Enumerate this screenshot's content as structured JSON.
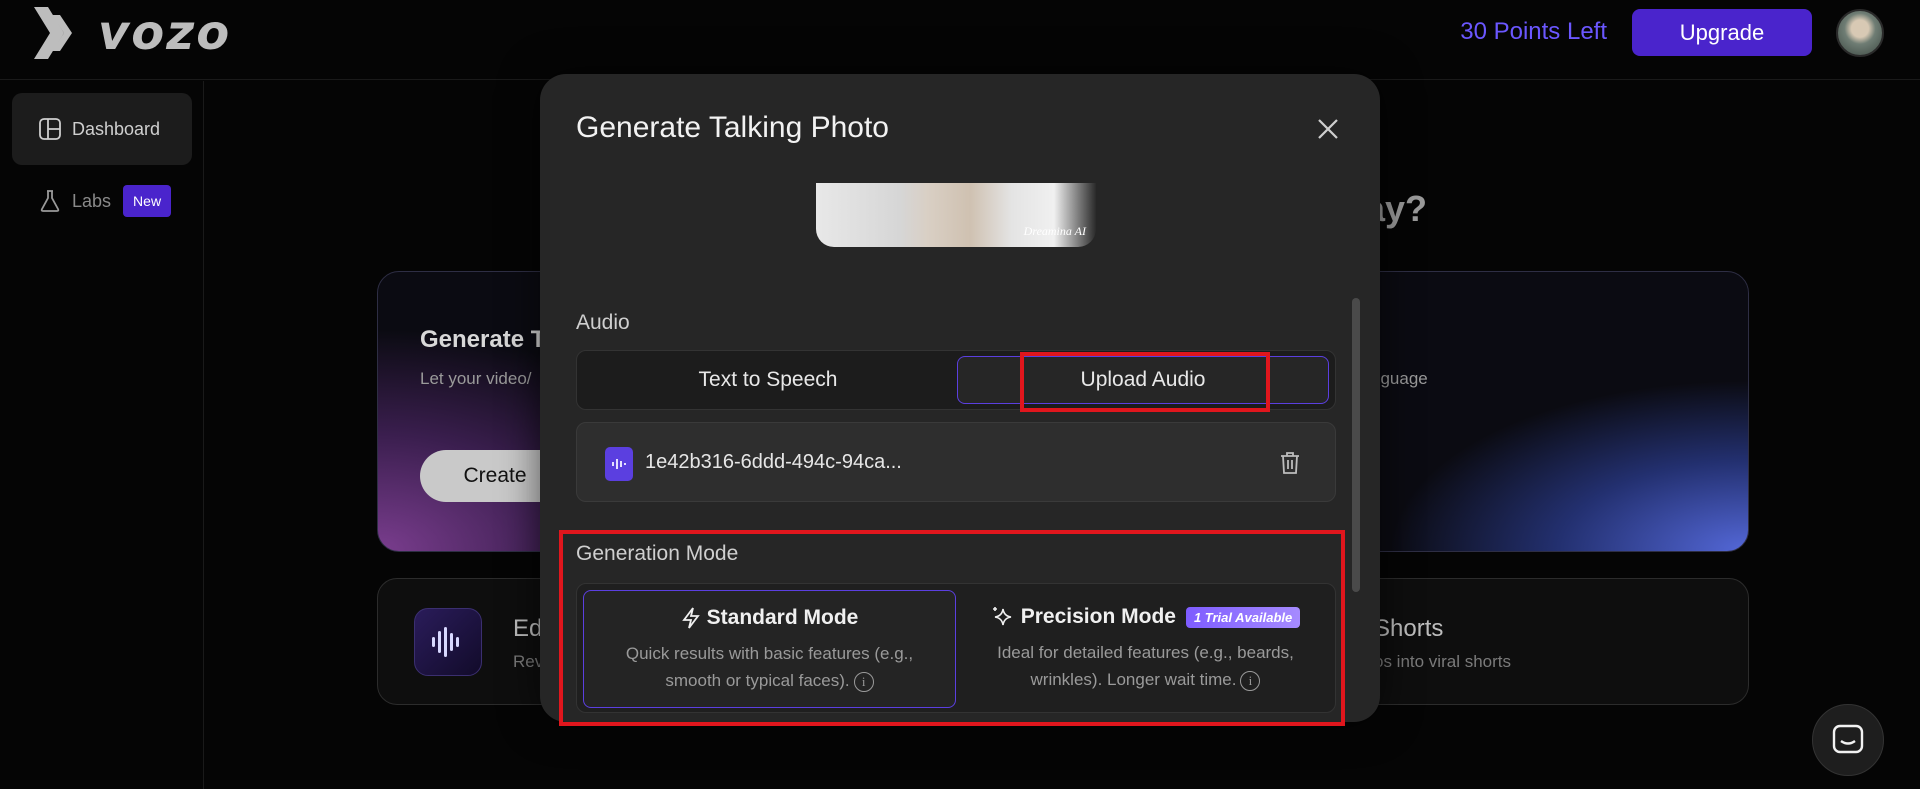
{
  "header": {
    "logo_text": "vozo",
    "points": "30 Points Left",
    "upgrade_label": "Upgrade"
  },
  "sidebar": {
    "items": [
      {
        "label": "Dashboard",
        "icon": "layout-icon",
        "active": true
      },
      {
        "label": "Labs",
        "icon": "flask-icon",
        "badge": "New"
      }
    ]
  },
  "main": {
    "question_partial": "lay?",
    "hero": {
      "title_partial": "Generate T",
      "subtitle_partial": "Let your video/",
      "subtitle_right_partial": "nguage",
      "create_label": "Create"
    },
    "tools": {
      "left_title_partial": "Ed",
      "left_sub_partial": "Rev",
      "right_title_partial": "Shorts",
      "right_sub_partial": "os into viral shorts"
    }
  },
  "modal": {
    "title": "Generate Talking Photo",
    "photo_watermark": "Dreamina AI",
    "audio_label": "Audio",
    "audio_tabs": [
      "Text to Speech",
      "Upload Audio"
    ],
    "audio_selected": "Upload Audio",
    "file_name": "1e42b316-6ddd-494c-94ca...",
    "generation_mode_label": "Generation Mode",
    "modes": [
      {
        "title": "Standard Mode",
        "desc": "Quick results with basic features (e.g., smooth or typical faces).",
        "icon": "lightning-icon",
        "selected": true
      },
      {
        "title": "Precision Mode",
        "desc": "Ideal for detailed features (e.g., beards, wrinkles). Longer wait time.",
        "icon": "sparkle-icon",
        "badge": "1 Trial Available"
      }
    ]
  },
  "colors": {
    "accent": "#5b3fe0",
    "brand": "#4a24cc",
    "highlight": "#e0161d"
  }
}
